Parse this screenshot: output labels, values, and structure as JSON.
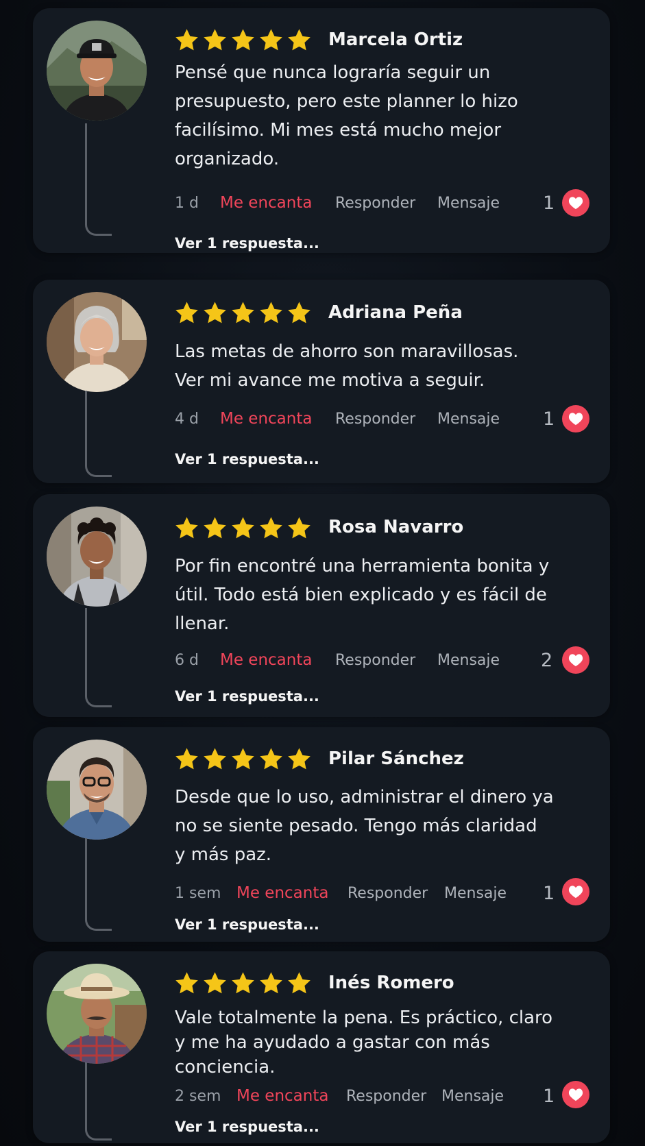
{
  "reviews": [
    {
      "name": "Marcela Ortiz",
      "rating": 5,
      "text_lines": [
        "Pensé que nunca lograría seguir un",
        "presupuesto, pero este planner lo hizo",
        "facilísimo. Mi mes está mucho mejor",
        "organizado."
      ],
      "time": "1 d",
      "love_label": "Me encanta",
      "reply_label": "Responder",
      "message_label": "Mensaje",
      "likes": "1",
      "replies_label": "Ver 1 respuesta..."
    },
    {
      "name": "Adriana Peña",
      "rating": 5,
      "text_lines": [
        "Las metas de ahorro son maravillosas.",
        "Ver mi avance me motiva a seguir."
      ],
      "time": "4 d",
      "love_label": "Me encanta",
      "reply_label": "Responder",
      "message_label": "Mensaje",
      "likes": "1",
      "replies_label": "Ver 1 respuesta..."
    },
    {
      "name": "Rosa Navarro",
      "rating": 5,
      "text_lines": [
        "Por fin encontré una herramienta bonita y",
        "útil. Todo está bien explicado y es fácil de",
        "llenar."
      ],
      "time": "6 d",
      "love_label": "Me encanta",
      "reply_label": "Responder",
      "message_label": "Mensaje",
      "likes": "2",
      "replies_label": "Ver 1 respuesta..."
    },
    {
      "name": "Pilar Sánchez",
      "rating": 5,
      "text_lines": [
        "Desde que lo uso, administrar el dinero ya",
        "no se siente pesado. Tengo más claridad",
        "y más paz."
      ],
      "time": "1 sem",
      "love_label": "Me encanta",
      "reply_label": "Responder",
      "message_label": "Mensaje",
      "likes": "1",
      "replies_label": "Ver 1 respuesta..."
    },
    {
      "name": "Inés Romero",
      "rating": 5,
      "text_lines": [
        "Vale totalmente la pena. Es práctico, claro",
        "y me ha ayudado a gastar con más",
        "conciencia."
      ],
      "time": "2 sem",
      "love_label": "Me encanta",
      "reply_label": "Responder",
      "message_label": "Mensaje",
      "likes": "1",
      "replies_label": "Ver 1 respuesta..."
    }
  ],
  "colors": {
    "star": "#f5c518",
    "love": "#f0455a",
    "card": "#141a22",
    "background": "#0a0e14"
  },
  "icons": {
    "star": "star-icon",
    "heart": "heart-icon",
    "avatar": "profile-photo"
  }
}
